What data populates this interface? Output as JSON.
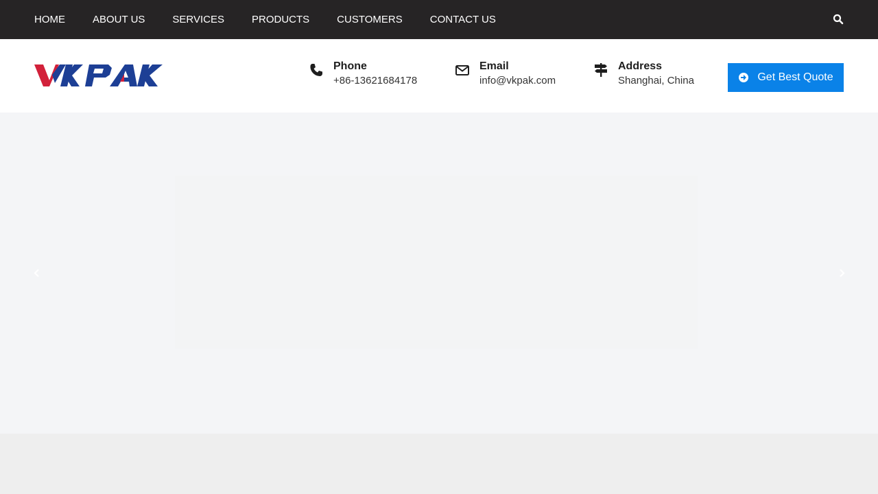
{
  "nav": {
    "items": [
      {
        "label": "HOME",
        "active": true
      },
      {
        "label": "ABOUT US"
      },
      {
        "label": "SERVICES"
      },
      {
        "label": "PRODUCTS"
      },
      {
        "label": "CUSTOMERS"
      },
      {
        "label": "CONTACT US"
      }
    ],
    "search_icon": "search-icon"
  },
  "header": {
    "logo_text": "VKPAK",
    "phone": {
      "label": "Phone",
      "value": "+86-13621684178",
      "icon": "phone-icon"
    },
    "email": {
      "label": "Email",
      "value": "info@vkpak.com",
      "icon": "envelope-icon"
    },
    "address": {
      "label": "Address",
      "value": "Shanghai, China",
      "icon": "signpost-icon"
    },
    "quote_button": {
      "label": "Get Best Quote",
      "icon": "arrow-circle-right-icon"
    }
  },
  "hero": {
    "prev_icon": "chevron-left-icon",
    "next_icon": "chevron-right-icon"
  },
  "colors": {
    "topbar": "#262425",
    "accent": "#0a82e8",
    "logo_red": "#d2213a",
    "logo_blue": "#1d3f95"
  }
}
